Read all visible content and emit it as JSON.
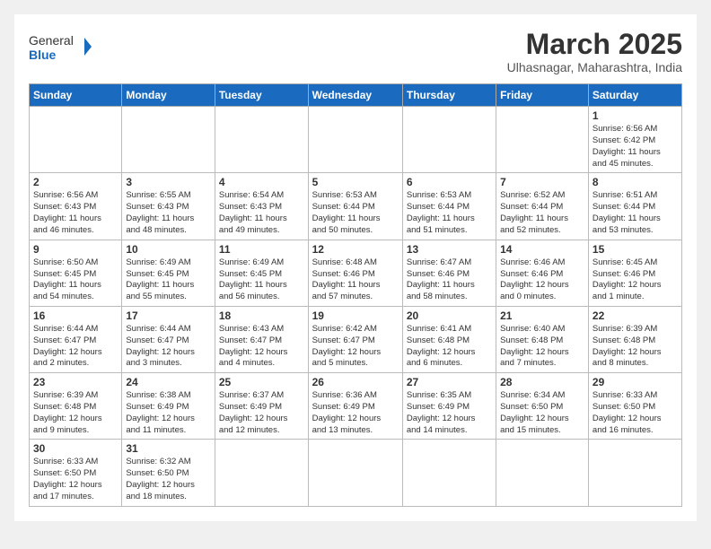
{
  "header": {
    "logo_general": "General",
    "logo_blue": "Blue",
    "month_title": "March 2025",
    "subtitle": "Ulhasnagar, Maharashtra, India"
  },
  "weekdays": [
    "Sunday",
    "Monday",
    "Tuesday",
    "Wednesday",
    "Thursday",
    "Friday",
    "Saturday"
  ],
  "weeks": [
    [
      {
        "day": "",
        "info": ""
      },
      {
        "day": "",
        "info": ""
      },
      {
        "day": "",
        "info": ""
      },
      {
        "day": "",
        "info": ""
      },
      {
        "day": "",
        "info": ""
      },
      {
        "day": "",
        "info": ""
      },
      {
        "day": "1",
        "info": "Sunrise: 6:56 AM\nSunset: 6:42 PM\nDaylight: 11 hours\nand 45 minutes."
      }
    ],
    [
      {
        "day": "2",
        "info": "Sunrise: 6:56 AM\nSunset: 6:43 PM\nDaylight: 11 hours\nand 46 minutes."
      },
      {
        "day": "3",
        "info": "Sunrise: 6:55 AM\nSunset: 6:43 PM\nDaylight: 11 hours\nand 48 minutes."
      },
      {
        "day": "4",
        "info": "Sunrise: 6:54 AM\nSunset: 6:43 PM\nDaylight: 11 hours\nand 49 minutes."
      },
      {
        "day": "5",
        "info": "Sunrise: 6:53 AM\nSunset: 6:44 PM\nDaylight: 11 hours\nand 50 minutes."
      },
      {
        "day": "6",
        "info": "Sunrise: 6:53 AM\nSunset: 6:44 PM\nDaylight: 11 hours\nand 51 minutes."
      },
      {
        "day": "7",
        "info": "Sunrise: 6:52 AM\nSunset: 6:44 PM\nDaylight: 11 hours\nand 52 minutes."
      },
      {
        "day": "8",
        "info": "Sunrise: 6:51 AM\nSunset: 6:44 PM\nDaylight: 11 hours\nand 53 minutes."
      }
    ],
    [
      {
        "day": "9",
        "info": "Sunrise: 6:50 AM\nSunset: 6:45 PM\nDaylight: 11 hours\nand 54 minutes."
      },
      {
        "day": "10",
        "info": "Sunrise: 6:49 AM\nSunset: 6:45 PM\nDaylight: 11 hours\nand 55 minutes."
      },
      {
        "day": "11",
        "info": "Sunrise: 6:49 AM\nSunset: 6:45 PM\nDaylight: 11 hours\nand 56 minutes."
      },
      {
        "day": "12",
        "info": "Sunrise: 6:48 AM\nSunset: 6:46 PM\nDaylight: 11 hours\nand 57 minutes."
      },
      {
        "day": "13",
        "info": "Sunrise: 6:47 AM\nSunset: 6:46 PM\nDaylight: 11 hours\nand 58 minutes."
      },
      {
        "day": "14",
        "info": "Sunrise: 6:46 AM\nSunset: 6:46 PM\nDaylight: 12 hours\nand 0 minutes."
      },
      {
        "day": "15",
        "info": "Sunrise: 6:45 AM\nSunset: 6:46 PM\nDaylight: 12 hours\nand 1 minute."
      }
    ],
    [
      {
        "day": "16",
        "info": "Sunrise: 6:44 AM\nSunset: 6:47 PM\nDaylight: 12 hours\nand 2 minutes."
      },
      {
        "day": "17",
        "info": "Sunrise: 6:44 AM\nSunset: 6:47 PM\nDaylight: 12 hours\nand 3 minutes."
      },
      {
        "day": "18",
        "info": "Sunrise: 6:43 AM\nSunset: 6:47 PM\nDaylight: 12 hours\nand 4 minutes."
      },
      {
        "day": "19",
        "info": "Sunrise: 6:42 AM\nSunset: 6:47 PM\nDaylight: 12 hours\nand 5 minutes."
      },
      {
        "day": "20",
        "info": "Sunrise: 6:41 AM\nSunset: 6:48 PM\nDaylight: 12 hours\nand 6 minutes."
      },
      {
        "day": "21",
        "info": "Sunrise: 6:40 AM\nSunset: 6:48 PM\nDaylight: 12 hours\nand 7 minutes."
      },
      {
        "day": "22",
        "info": "Sunrise: 6:39 AM\nSunset: 6:48 PM\nDaylight: 12 hours\nand 8 minutes."
      }
    ],
    [
      {
        "day": "23",
        "info": "Sunrise: 6:39 AM\nSunset: 6:48 PM\nDaylight: 12 hours\nand 9 minutes."
      },
      {
        "day": "24",
        "info": "Sunrise: 6:38 AM\nSunset: 6:49 PM\nDaylight: 12 hours\nand 11 minutes."
      },
      {
        "day": "25",
        "info": "Sunrise: 6:37 AM\nSunset: 6:49 PM\nDaylight: 12 hours\nand 12 minutes."
      },
      {
        "day": "26",
        "info": "Sunrise: 6:36 AM\nSunset: 6:49 PM\nDaylight: 12 hours\nand 13 minutes."
      },
      {
        "day": "27",
        "info": "Sunrise: 6:35 AM\nSunset: 6:49 PM\nDaylight: 12 hours\nand 14 minutes."
      },
      {
        "day": "28",
        "info": "Sunrise: 6:34 AM\nSunset: 6:50 PM\nDaylight: 12 hours\nand 15 minutes."
      },
      {
        "day": "29",
        "info": "Sunrise: 6:33 AM\nSunset: 6:50 PM\nDaylight: 12 hours\nand 16 minutes."
      }
    ],
    [
      {
        "day": "30",
        "info": "Sunrise: 6:33 AM\nSunset: 6:50 PM\nDaylight: 12 hours\nand 17 minutes."
      },
      {
        "day": "31",
        "info": "Sunrise: 6:32 AM\nSunset: 6:50 PM\nDaylight: 12 hours\nand 18 minutes."
      },
      {
        "day": "",
        "info": ""
      },
      {
        "day": "",
        "info": ""
      },
      {
        "day": "",
        "info": ""
      },
      {
        "day": "",
        "info": ""
      },
      {
        "day": "",
        "info": ""
      }
    ]
  ]
}
